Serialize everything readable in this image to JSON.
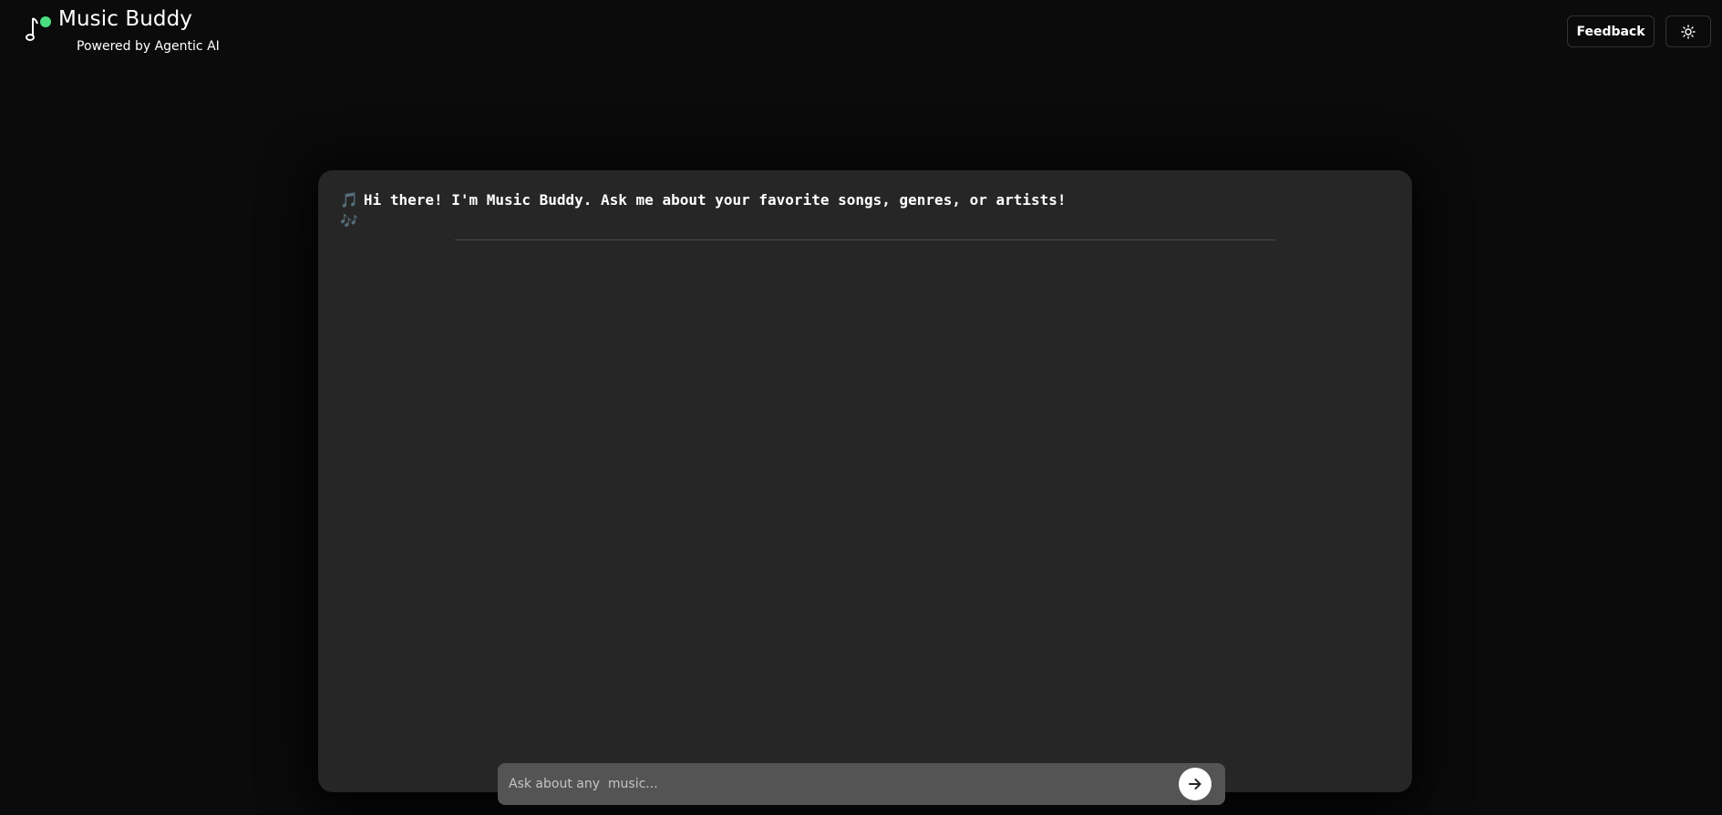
{
  "header": {
    "title": "Music Buddy",
    "subtitle": "Powered by Agentic AI",
    "feedback_label": "Feedback",
    "logo_icon": "music-note-icon",
    "theme_icon": "sun-icon"
  },
  "chat": {
    "welcome_message": "Hi there! I'm Music Buddy. Ask me about your favorite songs, genres, or artists!",
    "welcome_prefix_icon": "🎵",
    "welcome_suffix_icon": "🎶"
  },
  "input": {
    "placeholder": "Ask about any  music...",
    "value": "",
    "send_icon": "arrow-right-icon"
  },
  "colors": {
    "background": "#0b0b0b",
    "panel": "#262626",
    "input": "#545454",
    "accent_green": "#4ade80",
    "text": "#ffffff"
  }
}
